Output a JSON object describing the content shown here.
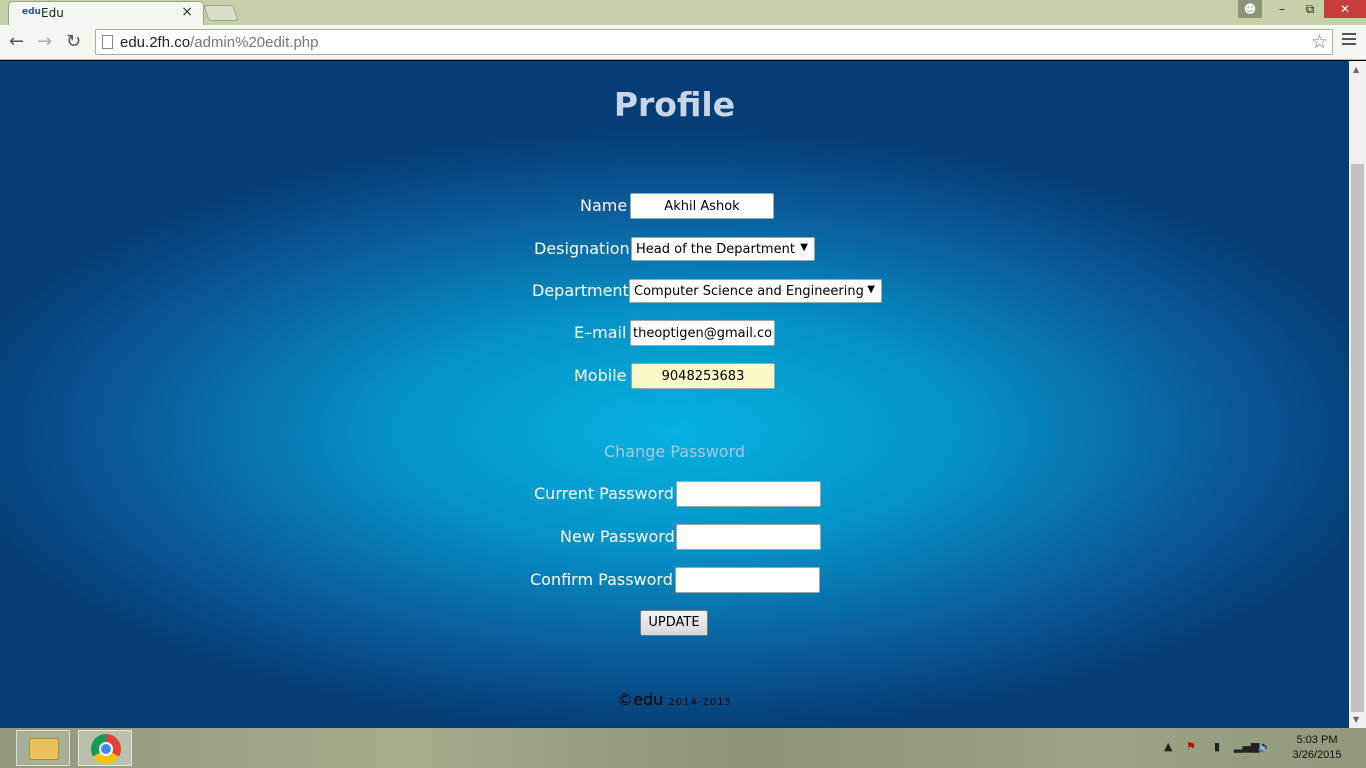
{
  "browser": {
    "tab_title": "Edu",
    "tab_favicon": "edu",
    "url_host": "edu.2fh.co",
    "url_path": "/admin%20edit.php"
  },
  "page": {
    "title": "Profile",
    "name_label": "Name",
    "name_value": "Akhil Ashok",
    "designation_label": "Designation",
    "designation_value": "Head of the Department",
    "department_label": "Department",
    "department_value": "Computer Science and Engineering",
    "email_label": "E–mail",
    "email_value": "theoptigen@gmail.com",
    "mobile_label": "Mobile",
    "mobile_value": "9048253683",
    "change_password_heading": "Change Password",
    "current_password_label": "Current Password",
    "new_password_label": "New Password",
    "confirm_password_label": "Confirm Password",
    "update_button": "UPDATE",
    "footer_brand": "©edu",
    "footer_years": "2014-2015"
  },
  "taskbar": {
    "time": "5:03 PM",
    "date": "3/26/2015"
  }
}
